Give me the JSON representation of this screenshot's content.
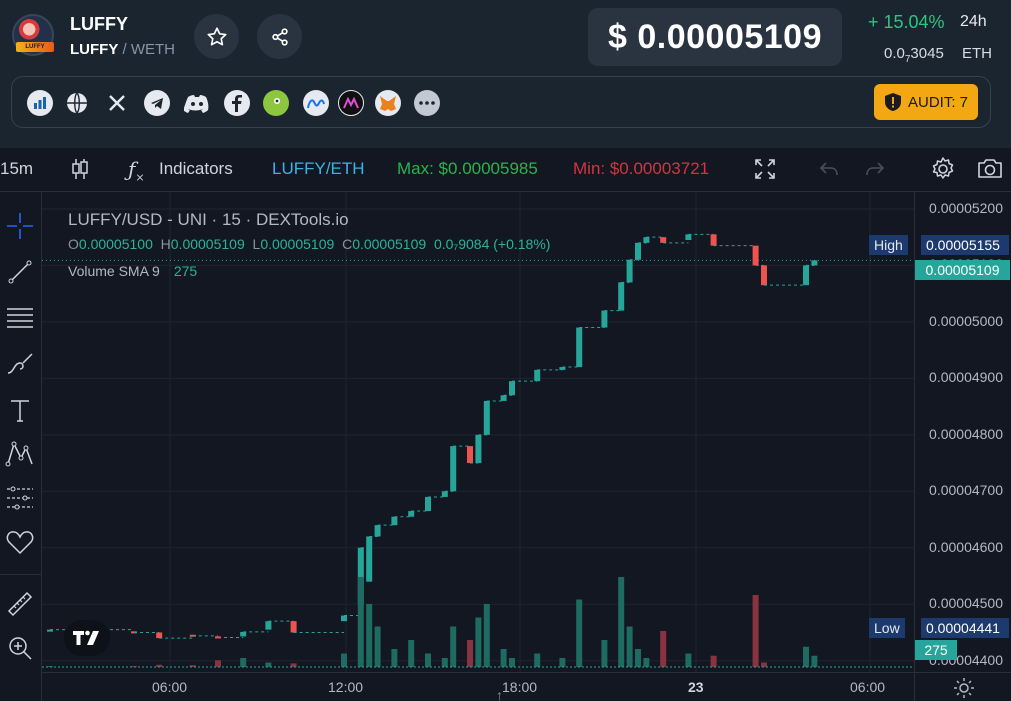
{
  "token": {
    "name": "LUFFY",
    "base": "LUFFY",
    "separator": " / ",
    "quote": "WETH",
    "logo_text": "LUFFY"
  },
  "price": {
    "usd": "$ 0.00005109",
    "change": "+ 15.04%",
    "change_period": "24h",
    "eth_prefix": "0.0",
    "eth_sub": "7",
    "eth_suffix": "3045",
    "eth_label": "ETH"
  },
  "links": {
    "icons": [
      "dextools-icon",
      "globe-icon",
      "x-icon",
      "telegram-icon",
      "discord-icon",
      "facebook-icon",
      "coingecko-icon",
      "coinmarketcap-icon",
      "mobula-icon",
      "metamask-icon",
      "more-icon"
    ],
    "audit_label": "AUDIT: 7"
  },
  "toolbar": {
    "interval": "15m",
    "indicators": "Indicators",
    "pair": "LUFFY/ETH",
    "max": "Max: $0.00005985",
    "min": "Min: $0.00003721"
  },
  "chart_legend": {
    "title": "LUFFY/USD - UNI · 15 · DEXTools.io",
    "o_label": "O",
    "o": "0.00005100",
    "h_label": "H",
    "h": "0.00005109",
    "l_label": "L",
    "l": "0.00005109",
    "c_label": "C",
    "c": "0.00005109",
    "change": "0.0₇9084 (+0.18%)",
    "volume_label": "Volume SMA 9",
    "volume_value": "275"
  },
  "price_scale": {
    "ticks": [
      "0.00005200",
      "0.00005100",
      "0.00005000",
      "0.00004900",
      "0.00004800",
      "0.00004700",
      "0.00004600",
      "0.00004500",
      "0.00004400"
    ],
    "high_label": "High",
    "high_value": "0.00005155",
    "current_value": "0.00005109",
    "low_label": "Low",
    "low_value": "0.00004441",
    "volume_tag": "275"
  },
  "time_scale": {
    "ticks": [
      "06:00",
      "12:00",
      "18:00",
      "23",
      "06:00"
    ]
  },
  "colors": {
    "up": "#26a69a",
    "down": "#ef5350",
    "accent_green": "#2fc47f",
    "audit": "#f3a712",
    "high_tag": "#1d3a6e",
    "current_tag": "#26a69a"
  },
  "chart_data": {
    "type": "candlestick",
    "title": "LUFFY/USD - UNI · 15 · DEXTools.io",
    "ylim": [
      4.38e-05,
      5.23e-05
    ],
    "series": [
      {
        "t": 0.0,
        "o": 4.455e-05,
        "c": 4.455e-05,
        "v": 2
      },
      {
        "t": 0.1,
        "o": 4.452e-05,
        "c": 4.45e-05,
        "v": 2
      },
      {
        "t": 0.13,
        "o": 4.45e-05,
        "c": 4.44e-05,
        "v": 5
      },
      {
        "t": 0.17,
        "o": 4.446e-05,
        "c": 4.444e-05,
        "v": 4
      },
      {
        "t": 0.2,
        "o": 4.443e-05,
        "c": 4.441e-05,
        "v": 15
      },
      {
        "t": 0.23,
        "o": 4.443e-05,
        "c": 4.451e-05,
        "v": 20
      },
      {
        "t": 0.26,
        "o": 4.455e-05,
        "c": 4.47e-05,
        "v": 10
      },
      {
        "t": 0.29,
        "o": 4.47e-05,
        "c": 4.45e-05,
        "v": 8
      },
      {
        "t": 0.35,
        "o": 4.47e-05,
        "c": 4.48e-05,
        "v": 30
      },
      {
        "t": 0.37,
        "o": 4.5e-05,
        "c": 4.6e-05,
        "v": 200
      },
      {
        "t": 0.38,
        "o": 4.54e-05,
        "c": 4.62e-05,
        "v": 140
      },
      {
        "t": 0.39,
        "o": 4.62e-05,
        "c": 4.64e-05,
        "v": 90
      },
      {
        "t": 0.41,
        "o": 4.64e-05,
        "c": 4.655e-05,
        "v": 40
      },
      {
        "t": 0.43,
        "o": 4.655e-05,
        "c": 4.665e-05,
        "v": 60
      },
      {
        "t": 0.45,
        "o": 4.665e-05,
        "c": 4.69e-05,
        "v": 30
      },
      {
        "t": 0.47,
        "o": 4.69e-05,
        "c": 4.7e-05,
        "v": 20
      },
      {
        "t": 0.48,
        "o": 4.7e-05,
        "c": 4.78e-05,
        "v": 90
      },
      {
        "t": 0.5,
        "o": 4.78e-05,
        "c": 4.75e-05,
        "v": 60
      },
      {
        "t": 0.51,
        "o": 4.75e-05,
        "c": 4.8e-05,
        "v": 110
      },
      {
        "t": 0.52,
        "o": 4.8e-05,
        "c": 4.86e-05,
        "v": 140
      },
      {
        "t": 0.54,
        "o": 4.86e-05,
        "c": 4.87e-05,
        "v": 40
      },
      {
        "t": 0.55,
        "o": 4.87e-05,
        "c": 4.895e-05,
        "v": 20
      },
      {
        "t": 0.58,
        "o": 4.895e-05,
        "c": 4.915e-05,
        "v": 30
      },
      {
        "t": 0.61,
        "o": 4.915e-05,
        "c": 4.92e-05,
        "v": 20
      },
      {
        "t": 0.63,
        "o": 4.92e-05,
        "c": 4.99e-05,
        "v": 150
      },
      {
        "t": 0.66,
        "o": 4.99e-05,
        "c": 5.02e-05,
        "v": 60
      },
      {
        "t": 0.68,
        "o": 5.02e-05,
        "c": 5.07e-05,
        "v": 200
      },
      {
        "t": 0.69,
        "o": 5.07e-05,
        "c": 5.11e-05,
        "v": 90
      },
      {
        "t": 0.7,
        "o": 5.11e-05,
        "c": 5.14e-05,
        "v": 40
      },
      {
        "t": 0.71,
        "o": 5.14e-05,
        "c": 5.15e-05,
        "v": 20
      },
      {
        "t": 0.73,
        "o": 5.15e-05,
        "c": 5.14e-05,
        "v": 80
      },
      {
        "t": 0.76,
        "o": 5.145e-05,
        "c": 5.155e-05,
        "v": 30
      },
      {
        "t": 0.79,
        "o": 5.155e-05,
        "c": 5.135e-05,
        "v": 25
      },
      {
        "t": 0.84,
        "o": 5.135e-05,
        "c": 5.1e-05,
        "v": 160
      },
      {
        "t": 0.85,
        "o": 5.1e-05,
        "c": 5.065e-05,
        "v": 10
      },
      {
        "t": 0.9,
        "o": 5.065e-05,
        "c": 5.1e-05,
        "v": 45
      },
      {
        "t": 0.91,
        "o": 5.1e-05,
        "c": 5.109e-05,
        "v": 25
      }
    ]
  }
}
